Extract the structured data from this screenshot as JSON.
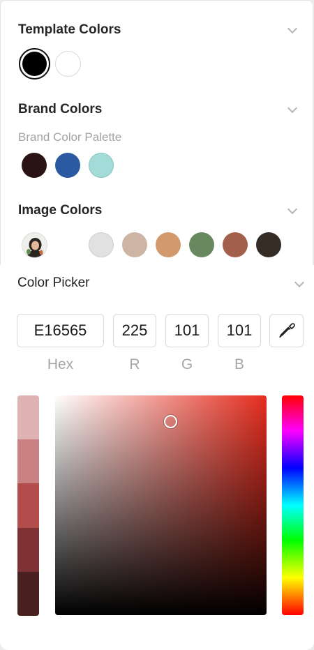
{
  "template_colors": {
    "title": "Template Colors",
    "swatches": [
      {
        "name": "black",
        "color": "#000000",
        "selected": true
      },
      {
        "name": "white",
        "color": "#ffffff",
        "selected": false
      }
    ]
  },
  "brand_colors": {
    "title": "Brand Colors",
    "palette_label": "Brand Color Palette",
    "swatches": [
      {
        "color": "#2a1314"
      },
      {
        "color": "#2b5aa2"
      },
      {
        "color": "#a3dbd9"
      }
    ]
  },
  "image_colors": {
    "title": "Image Colors",
    "swatches": [
      {
        "color": "#e2e1e2"
      },
      {
        "color": "#cdb4a4"
      },
      {
        "color": "#d29a6c"
      },
      {
        "color": "#688860"
      },
      {
        "color": "#a15f4c"
      },
      {
        "color": "#362c26"
      }
    ]
  },
  "color_picker": {
    "title": "Color Picker",
    "hex": "E16565",
    "r": "225",
    "g": "101",
    "b": "101",
    "labels": {
      "hex": "Hex",
      "r": "R",
      "g": "G",
      "b": "B"
    },
    "shades": [
      "#dfb3b4",
      "#c98181",
      "#b34d4b",
      "#7e3133",
      "#4a1f20"
    ],
    "hue_color": "#e52d1e"
  },
  "icons": {
    "chevron": "chevron-down-icon",
    "eyedropper": "eyedropper-icon",
    "image_thumb": "image-thumbnail-icon"
  }
}
